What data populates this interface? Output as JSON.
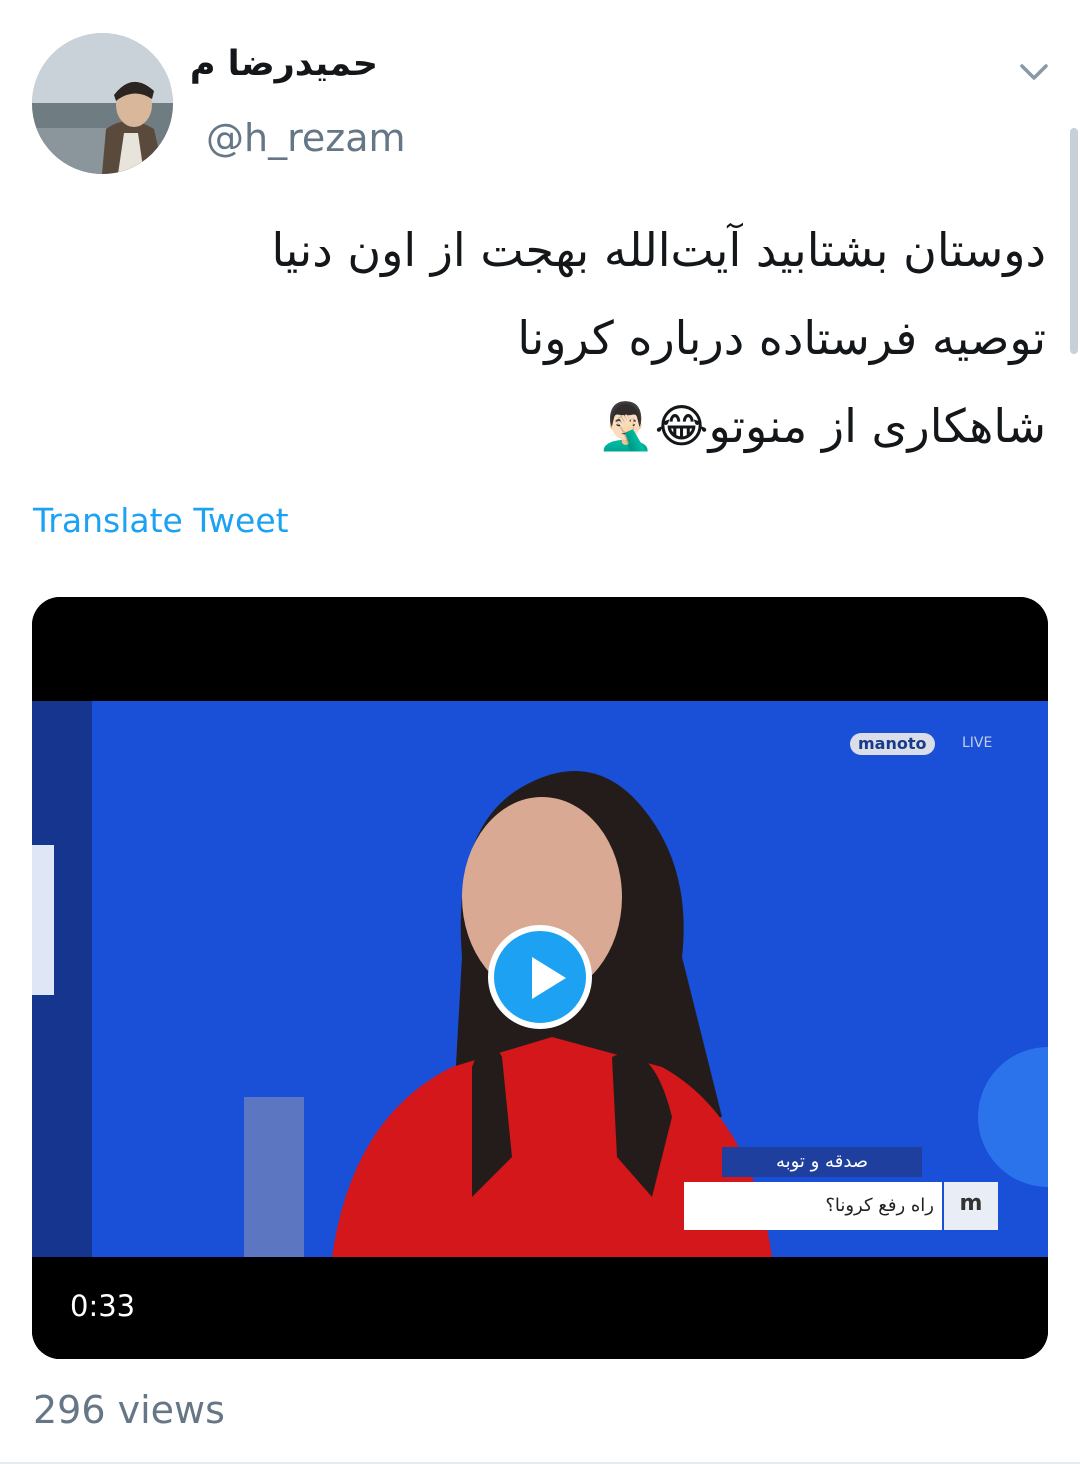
{
  "tweet": {
    "display_name": "حمیدرضا م",
    "handle": "@h_rezam",
    "text_lines": [
      "دوستان بشتابید آیت‌الله بهجت از اون دنیا",
      "توصیه فرستاده درباره کرونا",
      "شاهکاری از منوتو😂🤦🏻‍♂️"
    ],
    "translate_label": "Translate Tweet",
    "views": "296 views"
  },
  "video": {
    "duration": "0:33",
    "channel_logo": "manoto",
    "channel_logo_suffix": "LIVE",
    "lower_third_title": "صدقه و توبه",
    "lower_third_text": "راه رفع کرونا؟",
    "channel_badge": "m"
  },
  "icons": {
    "menu": "chevron-down-icon",
    "play": "play-icon"
  },
  "colors": {
    "accent": "#1da1f2",
    "secondary_text": "#657786",
    "primary_text": "#14171a",
    "studio_blue": "#1a4fd8",
    "dress_red": "#d4171b"
  }
}
